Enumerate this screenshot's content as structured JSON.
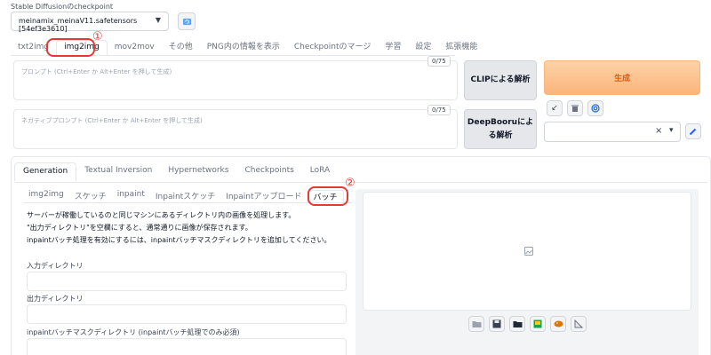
{
  "checkpoint": {
    "label": "Stable Diffusionのcheckpoint",
    "value": "meinamix_meinaV11.safetensors [54ef3e3610]"
  },
  "top_tabs": [
    "txt2img",
    "img2img",
    "mov2mov",
    "その他",
    "PNG内の情報を表示",
    "Checkpointのマージ",
    "学習",
    "設定",
    "拡張機能"
  ],
  "prompt": {
    "placeholder": "プロンプト (Ctrl+Enter か Alt+Enter を押して生成)",
    "counter": "0/75"
  },
  "negative_prompt": {
    "placeholder": "ネガティブプロンプト (Ctrl+Enter か Alt+Enter を押して生成)",
    "counter": "0/75"
  },
  "buttons": {
    "clip": "CLIPによる解析",
    "deepbooru_line1": "DeepBooruによ",
    "deepbooru_line2": "る解析",
    "generate": "生成"
  },
  "styles": {
    "clear": "×",
    "caret": "▾"
  },
  "gen_tabs": [
    "Generation",
    "Textual Inversion",
    "Hypernetworks",
    "Checkpoints",
    "LoRA"
  ],
  "sub_tabs": [
    "img2img",
    "スケッチ",
    "inpaint",
    "Inpaintスケッチ",
    "Inpaintアップロード",
    "バッチ"
  ],
  "batch": {
    "desc_line1": "サーバーが稼働しているのと同じマシンにあるディレクトリ内の画像を処理します。",
    "desc_line2": "\"出力ディレクトリ\"を空欄にすると、通常通りに画像が保存されます。",
    "desc_line3": "inpaintバッチ処理を有効にするには、inpaintバッチマスクディレクトリを追加してください。",
    "input_dir_label": "入力ディレクトリ",
    "output_dir_label": "出力ディレクトリ",
    "mask_dir_label": "inpaintバッチマスクディレクトリ (inpaintバッチ処理でのみ必須)"
  },
  "annotations": {
    "circle1": "①",
    "circle2": "②"
  },
  "tool_icons": [
    "folder-icon",
    "save-icon",
    "zip-icon",
    "image-icon",
    "palette-icon",
    "ruler-icon"
  ],
  "colors": {
    "generate_text": "#ea580c",
    "generate_bg": "#fbb57a",
    "callout": "#e53935"
  }
}
